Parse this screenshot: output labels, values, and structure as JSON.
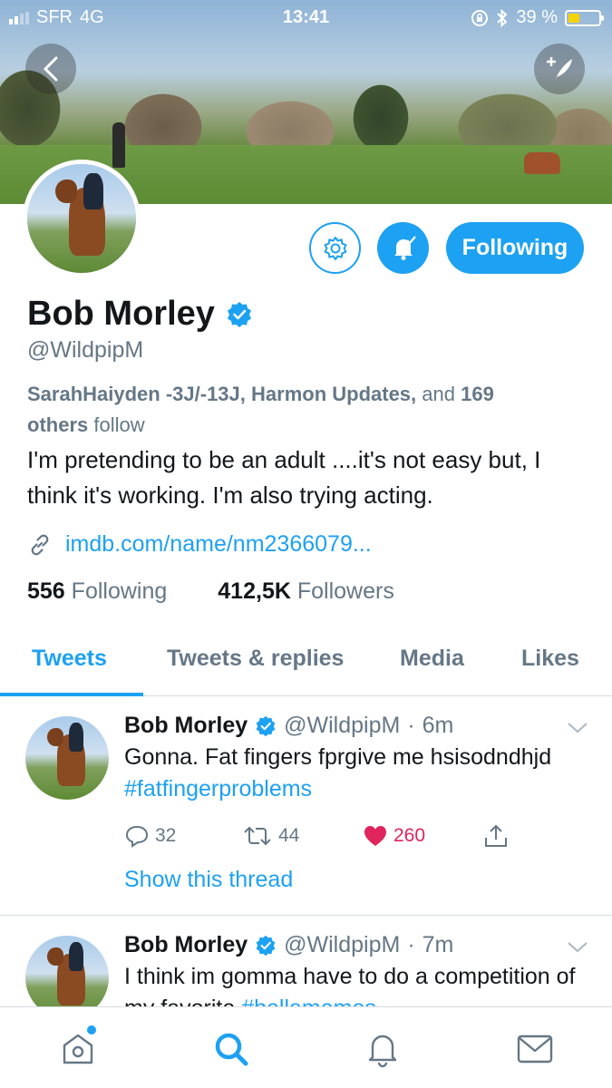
{
  "status_bar": {
    "carrier": "SFR",
    "network": "4G",
    "time": "13:41",
    "battery_percent": "39 %",
    "battery_level": 0.39
  },
  "profile": {
    "display_name": "Bob Morley",
    "handle": "@WildpipM",
    "verified": true,
    "followed_by": {
      "names": "SarahHaiyden -3J/-13J, Harmon Updates,",
      "and": "and",
      "count": "169",
      "others": "others",
      "follow": "follow"
    },
    "bio": "I'm pretending to be an adult ....it's not easy but, I think it's working. I'm also trying acting.",
    "link": "imdb.com/name/nm2366079...",
    "following_count": "556",
    "following_label": "Following",
    "followers_count": "412,5K",
    "followers_label": "Followers",
    "follow_button": "Following"
  },
  "tabs": [
    "Tweets",
    "Tweets & replies",
    "Media",
    "Likes"
  ],
  "active_tab": "Tweets",
  "tweets": [
    {
      "name": "Bob Morley",
      "handle": "@WildpipM",
      "time": "6m",
      "text": "Gonna. Fat fingers fprgive me hsisodndhjd ",
      "hashtag": "#fatfingerproblems",
      "replies": "32",
      "retweets": "44",
      "likes": "260",
      "show_thread": "Show this thread"
    },
    {
      "name": "Bob Morley",
      "handle": "@WildpipM",
      "time": "7m",
      "text": "I think im gomma have to do a competition of my favorite ",
      "hashtag": "#bellamemes"
    }
  ],
  "colors": {
    "accent": "#1da1f2",
    "like": "#e0245e",
    "secondary_text": "#657786"
  },
  "icons": {
    "back": "back-arrow-icon",
    "compose": "compose-icon",
    "settings": "gear-icon",
    "notifications": "bell-icon",
    "verified": "verified-badge-icon",
    "link": "link-icon",
    "reply": "reply-icon",
    "retweet": "retweet-icon",
    "like": "heart-icon",
    "share": "share-icon",
    "home": "home-icon",
    "search": "search-icon",
    "notifications_tab": "bell-icon",
    "messages": "mail-icon"
  }
}
